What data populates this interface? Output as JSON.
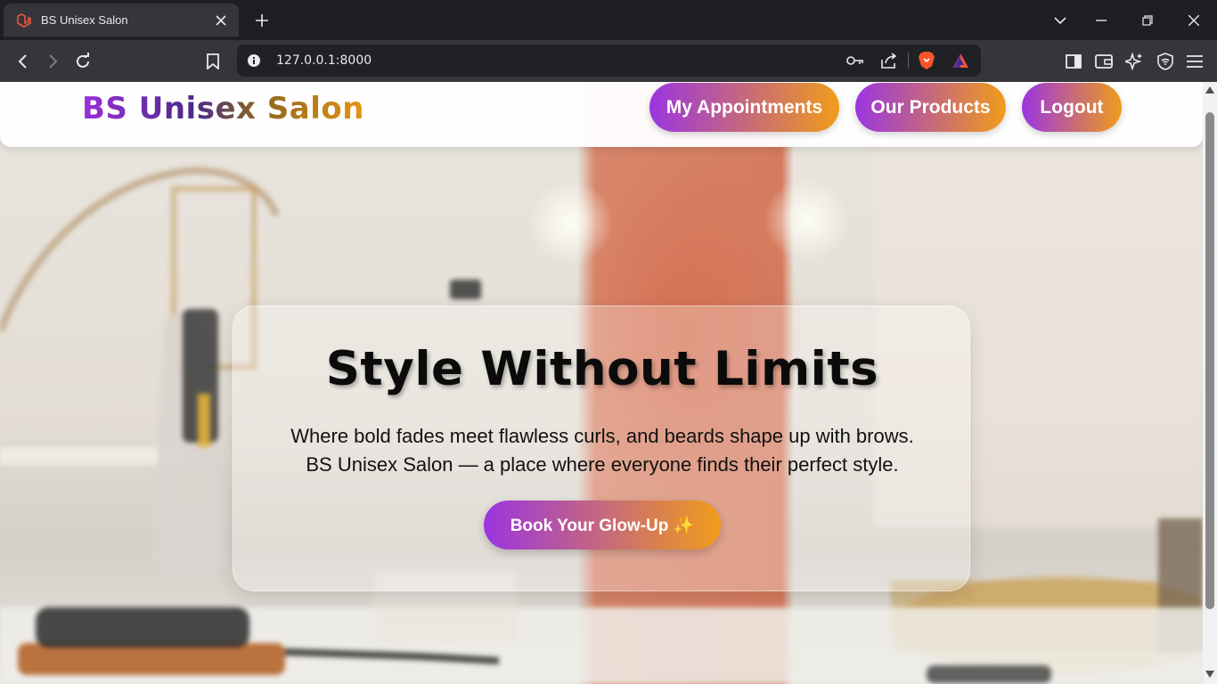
{
  "browser": {
    "tab_title": "BS Unisex Salon",
    "url": "127.0.0.1:8000",
    "icons": [
      "laravel-favicon",
      "close-icon",
      "plus-icon",
      "chevron-down-icon",
      "minimize-icon",
      "restore-icon",
      "window-close-icon",
      "back-icon",
      "forward-icon",
      "reload-icon",
      "bookmark-icon",
      "info-icon",
      "key-icon",
      "share-icon",
      "brave-shield-icon",
      "brave-rewards-icon",
      "sidebar-icon",
      "wallet-icon",
      "leo-ai-icon",
      "vpn-icon",
      "menu-icon"
    ]
  },
  "site": {
    "logo": "BS Unisex Salon",
    "nav": {
      "appointments": "My Appointments",
      "products": "Our Products",
      "logout": "Logout"
    },
    "hero": {
      "heading": "Style Without Limits",
      "line1": "Where bold fades meet flawless curls, and beards shape up with brows.",
      "line2": "BS Unisex Salon — a place where everyone finds their perfect style.",
      "cta": "Book Your Glow-Up ✨"
    }
  },
  "colors": {
    "gradient_start": "#9b35e0",
    "gradient_end": "#f09c1a",
    "chrome_dark": "#1f1f23",
    "chrome_toolbar": "#35363a"
  }
}
